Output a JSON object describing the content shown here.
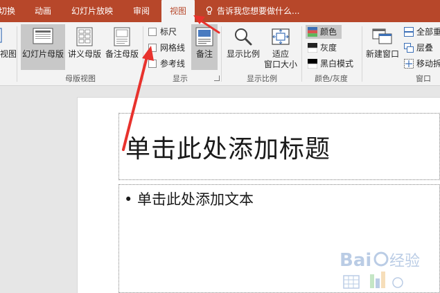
{
  "tabs": [
    {
      "label": "切换",
      "active": false
    },
    {
      "label": "动画",
      "active": false
    },
    {
      "label": "幻灯片放映",
      "active": false
    },
    {
      "label": "审阅",
      "active": false
    },
    {
      "label": "视图",
      "active": true
    }
  ],
  "tell_me": "告诉我您想要做什么...",
  "ribbon": {
    "views_partial": "视图",
    "master_views": {
      "group_label": "母版视图",
      "slide_master": "幻灯片母版",
      "handout_master": "讲义母版",
      "notes_master": "备注母版"
    },
    "show": {
      "group_label": "显示",
      "ruler": "标尺",
      "gridlines": "网格线",
      "guides": "参考线",
      "notes": "备注"
    },
    "zoom": {
      "group_label": "显示比例",
      "zoom": "显示比例",
      "fit_line1": "适应",
      "fit_line2": "窗口大小"
    },
    "color": {
      "group_label": "颜色/灰度",
      "color": "颜色",
      "grayscale": "灰度",
      "bw": "黑白模式"
    },
    "window": {
      "group_label": "窗口",
      "new_window": "新建窗口",
      "arrange_all": "全部重",
      "cascade": "层叠",
      "move_split": "移动拆"
    }
  },
  "slide": {
    "title_placeholder": "单击此处添加标题",
    "body_placeholder": "• 单击此处添加文本"
  },
  "colors": {
    "accent": "#b7472a",
    "arrow": "#e8322d"
  }
}
